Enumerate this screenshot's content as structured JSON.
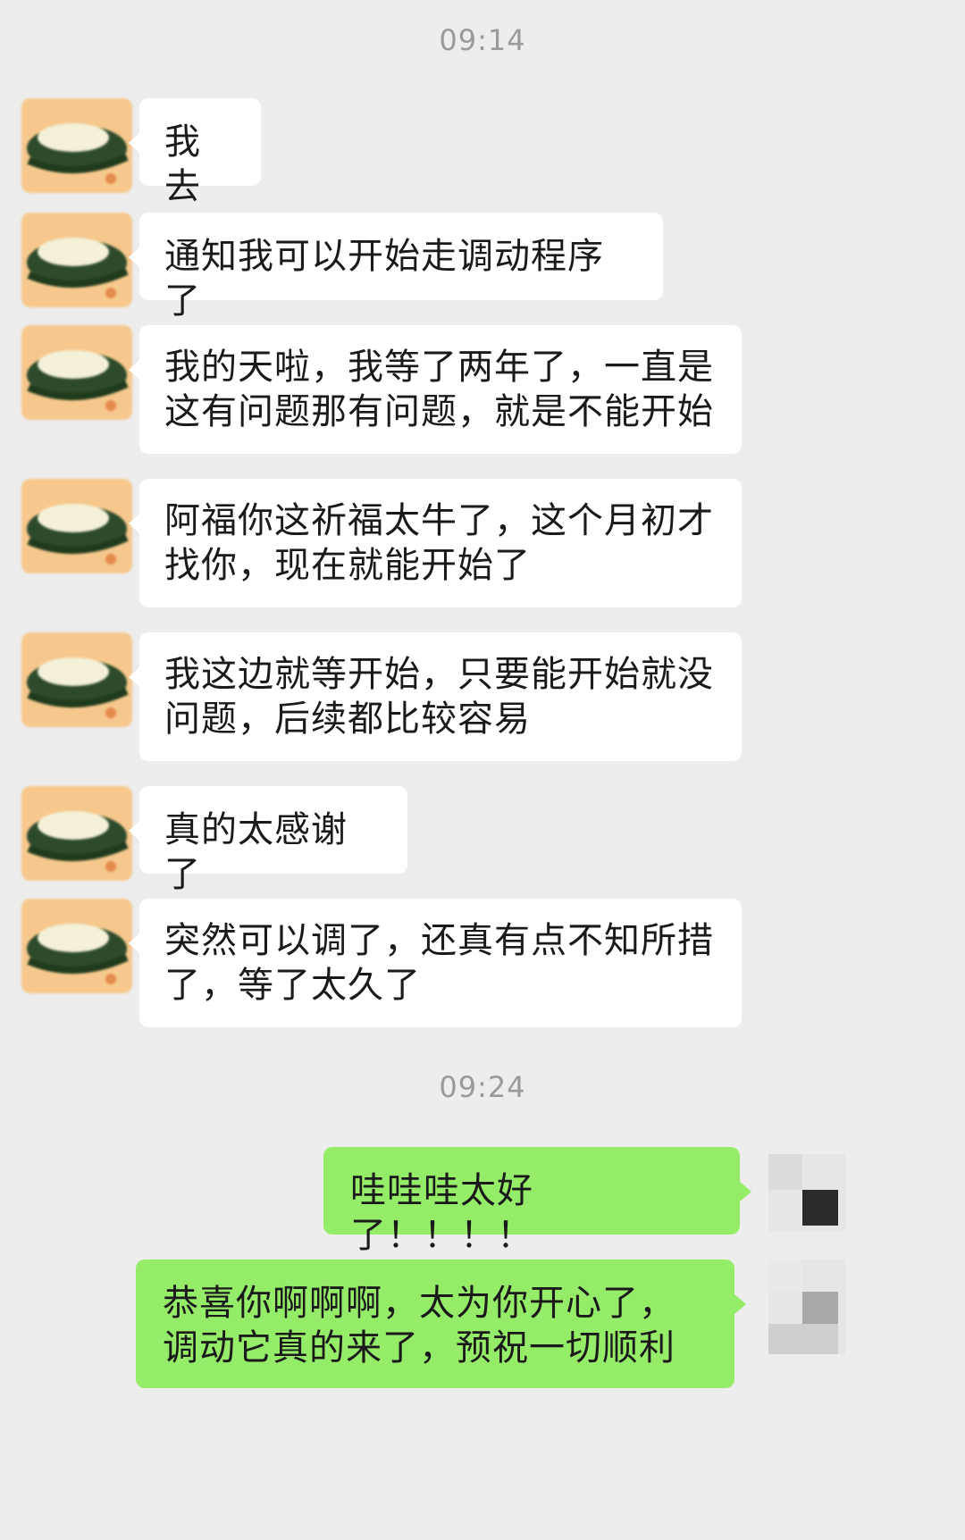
{
  "timestamps": [
    "09:14",
    "09:24"
  ],
  "messages": [
    {
      "side": "left",
      "text": "我去"
    },
    {
      "side": "left",
      "text": "通知我可以开始走调动程序了"
    },
    {
      "side": "left",
      "text": "我的天啦，我等了两年了，一直是这有问题那有问题，就是不能开始"
    },
    {
      "side": "left",
      "text": "阿福你这祈福太牛了，这个月初才找你，现在就能开始了"
    },
    {
      "side": "left",
      "text": "我这边就等开始，只要能开始就没问题，后续都比较容易"
    },
    {
      "side": "left",
      "text": "真的太感谢了"
    },
    {
      "side": "left",
      "text": "突然可以调了，还真有点不知所措了，等了太久了"
    },
    {
      "side": "right",
      "text": "哇哇哇太好了！！！！"
    },
    {
      "side": "right",
      "text": "恭喜你啊啊啊，太为你开心了，调动它真的来了，预祝一切顺利"
    }
  ],
  "colors": {
    "background": "#ededed",
    "incoming_bubble": "#ffffff",
    "outgoing_bubble": "#95ec69",
    "timestamp_text": "#9a9a9a"
  }
}
